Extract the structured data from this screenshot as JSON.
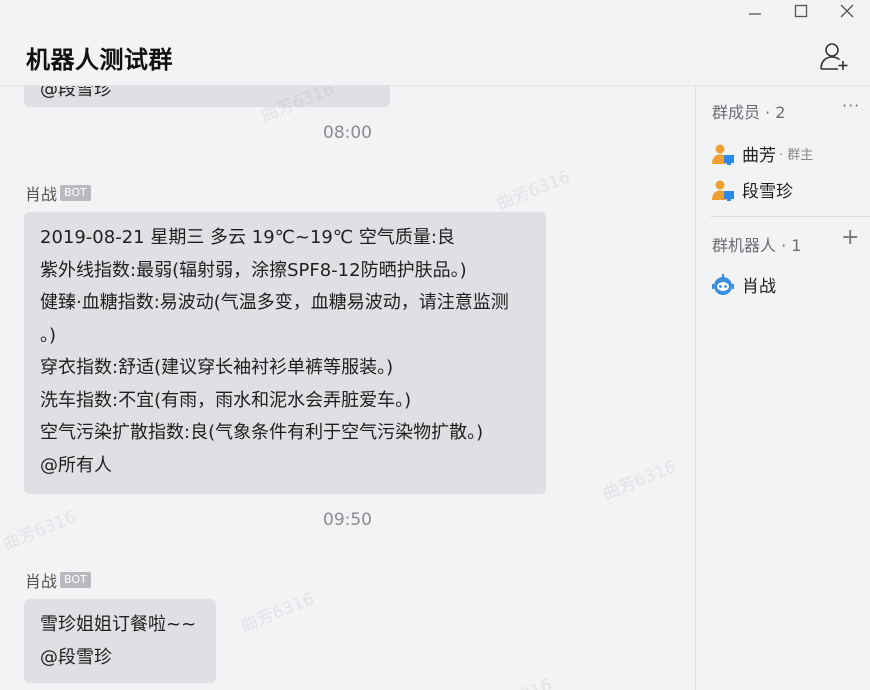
{
  "window": {
    "title": "机器人测试群",
    "controls": [
      "minimize-icon",
      "maximize-icon",
      "close-icon"
    ],
    "add_member_icon": "add-person-icon"
  },
  "chat": {
    "partial_top_mention": "@段雪珍",
    "messages": [
      {
        "time": "08:00",
        "sender": "肖战",
        "badge": "BOT",
        "lines": [
          "2019-08-21 星期三 多云 19℃~19℃ 空气质量:良",
          "紫外线指数:最弱(辐射弱，涂擦SPF8-12防晒护肤品。)",
          "健臻·血糖指数:易波动(气温多变，血糖易波动，请注意监测",
          "。)",
          "穿衣指数:舒适(建议穿长袖衬衫单裤等服装。)",
          "洗车指数:不宜(有雨，雨水和泥水会弄脏爱车。)",
          "空气污染扩散指数:良(气象条件有利于空气污染物扩散。)",
          "@所有人"
        ]
      },
      {
        "time": "09:50",
        "sender": "肖战",
        "badge": "BOT",
        "lines": [
          "雪珍姐姐订餐啦~~",
          "@段雪珍"
        ]
      }
    ],
    "watermark": "曲芳6316"
  },
  "sidebar": {
    "members_title": "群成员 · 2",
    "more_label": "···",
    "members": [
      {
        "name": "曲芳",
        "role": "· 群主"
      },
      {
        "name": "段雪珍",
        "role": ""
      }
    ],
    "robots_title": "群机器人 · 1",
    "add_label": "+",
    "robots": [
      {
        "name": "肖战"
      }
    ]
  },
  "colors": {
    "background": "#f2f3f5",
    "bubble": "#dfe0e3",
    "badge": "#b8babd",
    "avatar_orange": "#f0a030",
    "avatar_blue": "#2a8ce8",
    "robot_blue": "#3b8de0"
  }
}
